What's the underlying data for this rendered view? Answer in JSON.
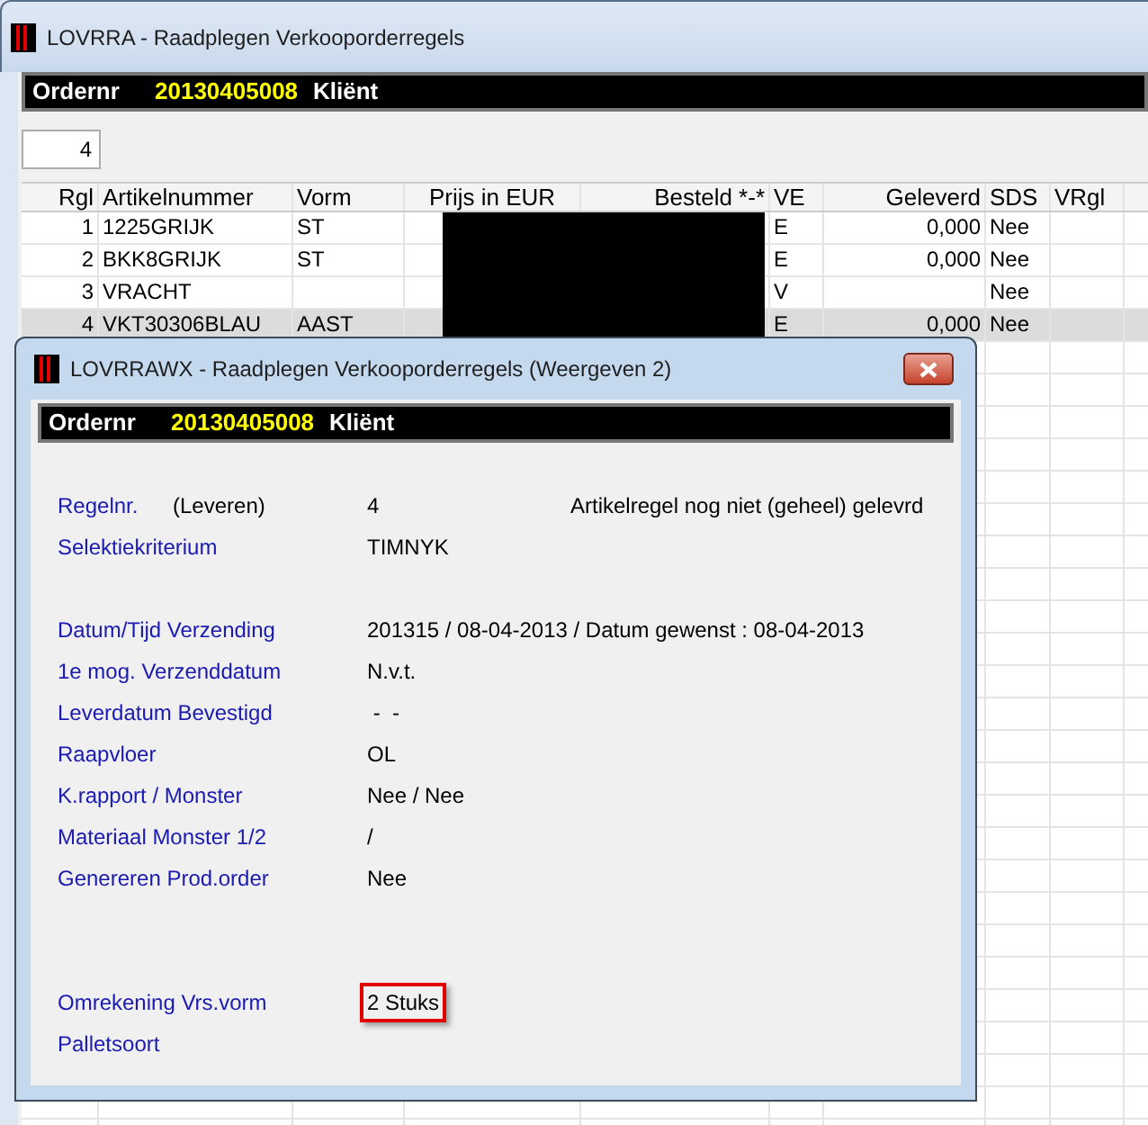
{
  "main_window": {
    "title": "LOVRRA - Raadplegen Verkooporderregels",
    "order_bar": {
      "label": "Ordernr",
      "number": "20130405008",
      "client_label": "Kliënt"
    },
    "record_field": {
      "value": "4"
    },
    "table": {
      "columns": [
        "Rgl",
        "Artikelnummer",
        "Vorm",
        "Prijs in EUR",
        "Besteld *-*",
        "VE",
        "Geleverd",
        "SDS",
        "VRgl"
      ],
      "rows": [
        {
          "rgl": "1",
          "artikelnummer": "1225GRIJK",
          "vorm": "ST",
          "ve": "E",
          "geleverd": "0,000",
          "sds": "Nee",
          "selected": false
        },
        {
          "rgl": "2",
          "artikelnummer": "BKK8GRIJK",
          "vorm": "ST",
          "ve": "E",
          "geleverd": "0,000",
          "sds": "Nee",
          "selected": false
        },
        {
          "rgl": "3",
          "artikelnummer": "VRACHT",
          "ve": "V",
          "sds": "Nee",
          "selected": false
        },
        {
          "rgl": "4",
          "artikelnummer": "VKT30306BLAU",
          "vorm": "AAST",
          "ve": "E",
          "geleverd": "0,000",
          "sds": "Nee",
          "selected": true
        }
      ]
    }
  },
  "dialog": {
    "title": "LOVRRAWX - Raadplegen Verkooporderregels (Weergeven 2)",
    "order_bar": {
      "label": "Ordernr",
      "number": "20130405008",
      "client_label": "Kliënt"
    },
    "sections": [
      [
        {
          "label": "Regelnr.",
          "sub_label": "(Leveren)",
          "value": "4",
          "note": "Artikelregel nog niet (geheel) gelevrd"
        },
        {
          "label": "Selektiekriterium",
          "value": "TIMNYK"
        }
      ],
      [
        {
          "label": "Datum/Tijd Verzending",
          "value": "201315 / 08-04-2013 / Datum gewenst : 08-04-2013"
        },
        {
          "label": "1e mog. Verzenddatum",
          "value": "N.v.t."
        },
        {
          "label": "Leverdatum Bevestigd",
          "value": " -  -"
        },
        {
          "label": "Raapvloer",
          "value": "OL"
        },
        {
          "label": "K.rapport / Monster",
          "value": "Nee / Nee"
        },
        {
          "label": "Materiaal Monster 1/2",
          "value": "/"
        },
        {
          "label": "Genereren Prod.order",
          "value": "Nee"
        }
      ],
      [
        {
          "label": "Omrekening Vrs.vorm",
          "value": "2 Stuks",
          "highlighted": true
        },
        {
          "label": "Palletsoort"
        }
      ]
    ]
  }
}
